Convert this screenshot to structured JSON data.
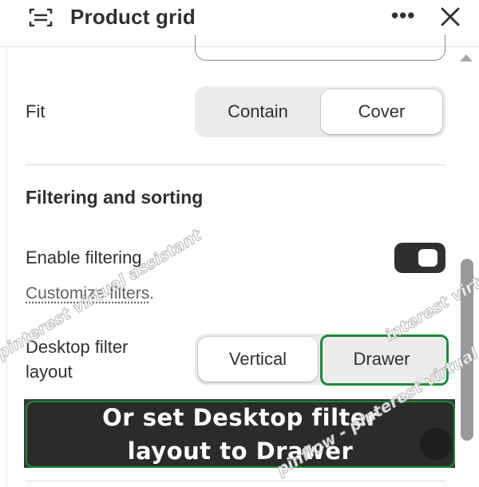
{
  "header": {
    "title": "Product grid",
    "icon": "grid-icon",
    "more_icon": "more-horizontal-icon",
    "more_glyph": "•••",
    "close_icon": "close-icon"
  },
  "image_fit": {
    "label": "Fit",
    "options": [
      "Contain",
      "Cover"
    ],
    "selected": "Cover"
  },
  "filtering": {
    "section_title": "Filtering and sorting",
    "enable_label": "Enable filtering",
    "enable_value": true,
    "customize_link": "Customize filters",
    "customize_suffix": ".",
    "layout_label": "Desktop filter\nlayout",
    "layout_options": [
      "Vertical",
      "Drawer"
    ],
    "layout_selected": "Vertical"
  },
  "callout": {
    "text": "Or set Desktop filter\nlayout to Drawer",
    "highlight_color": "#1f8a3c"
  },
  "watermarks": [
    "pinterest virtual assistant",
    "interest virtu",
    "pinflow - pinterest virtual"
  ],
  "colors": {
    "text": "#303030",
    "toggle_on": "#303030",
    "segment_bg": "#ebebeb",
    "highlight": "#1f8a3c"
  }
}
